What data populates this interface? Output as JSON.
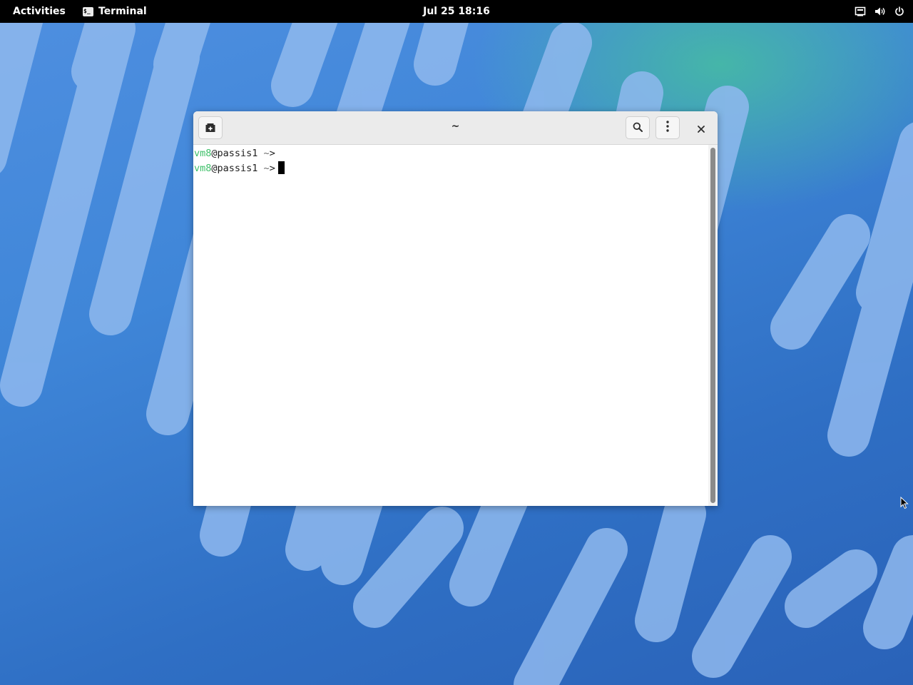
{
  "topbar": {
    "activities_label": "Activities",
    "app_name": "Terminal",
    "app_icon": "terminal-icon",
    "clock": "Jul 25  18:16",
    "status_icons": [
      "network-icon",
      "volume-icon",
      "power-icon"
    ]
  },
  "window": {
    "title": "~",
    "buttons": {
      "new_tab_icon": "new-tab-icon",
      "search_icon": "search-icon",
      "menu_icon": "kebab-menu-icon",
      "close_icon": "close-icon"
    }
  },
  "terminal": {
    "lines": [
      {
        "user": "vm8",
        "host": "@passis1",
        "path": " ~",
        "prompt": ">"
      },
      {
        "user": "vm8",
        "host": "@passis1",
        "path": " ~",
        "prompt": ">",
        "cursor": true
      }
    ]
  },
  "colors": {
    "topbar_bg": "#000000",
    "user_green": "#3fc06a",
    "headerbar_bg": "#ebebeb",
    "wallpaper_blue": "#3f86d8",
    "wallpaper_teal": "#46be a0"
  }
}
